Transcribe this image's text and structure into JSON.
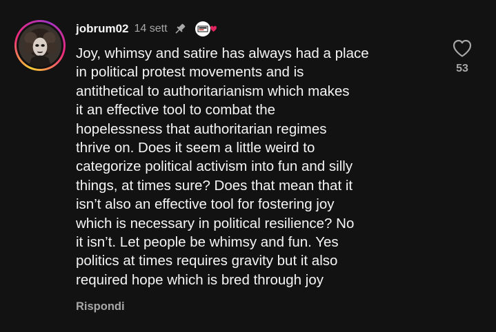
{
  "comment": {
    "username": "jobrum02",
    "timestamp": "14 sett",
    "text": "Joy, whimsy and satire has always had a place\nin political protest movements and is\nantithetical to authoritarianism which makes\nit an effective tool to combat the\nhopelessness that authoritarian regimes\nthrive on. Does it seem a little weird to\ncategorize political activism into fun and silly\nthings, at times sure? Does that mean that it\nisn’t also an effective tool for fostering joy\nwhich is necessary in political resilience? No\nit isn’t. Let people be whimsy and fun. Yes\npolitics at times requires gravity but it also\nrequired hope which is bred through joy",
    "reply_label": "Rispondi",
    "like_count": "53"
  },
  "icons": {
    "pin": "pin-icon",
    "badge": "creator-badge-icon",
    "like": "heart-icon"
  },
  "colors": {
    "background": "#121212",
    "text_primary": "#f5f5f5",
    "text_secondary": "#a8a8a8",
    "badge_heart": "#e0245e"
  }
}
